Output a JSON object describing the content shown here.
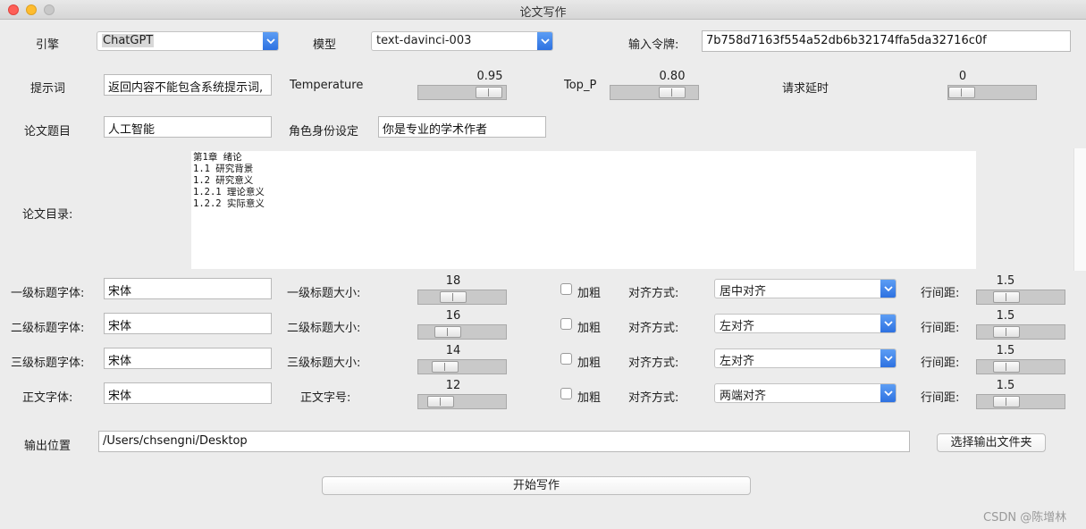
{
  "window": {
    "title": "论文写作"
  },
  "engine": {
    "label": "引擎",
    "value": "ChatGPT"
  },
  "model": {
    "label": "模型",
    "value": "text-davinci-003"
  },
  "token": {
    "label": "输入令牌:",
    "value": "7b758d7163f554a52db6b32174ffa5da32716c0f"
  },
  "prompt": {
    "label": "提示词",
    "value": "返回内容不能包含系统提示词,"
  },
  "temperature": {
    "label": "Temperature",
    "value": "0.95"
  },
  "top_p": {
    "label": "Top_P",
    "value": "0.80"
  },
  "delay": {
    "label": "请求延时",
    "value": "0"
  },
  "paper_title": {
    "label": "论文题目",
    "value": "人工智能"
  },
  "role": {
    "label": "角色身份设定",
    "value": "你是专业的学术作者"
  },
  "outline": {
    "label": "论文目录:",
    "text": "第1章 绪论\n1.1 研究背景\n1.2 研究意义\n1.2.1 理论意义\n1.2.2 实际意义"
  },
  "rows": [
    {
      "font_label": "一级标题字体:",
      "font": "宋体",
      "size_label": "一级标题大小:",
      "size": "18",
      "bold_label": "加粗",
      "align_label": "对齐方式:",
      "align": "居中对齐",
      "spacing_label": "行间距:",
      "spacing": "1.5"
    },
    {
      "font_label": "二级标题字体:",
      "font": "宋体",
      "size_label": "二级标题大小:",
      "size": "16",
      "bold_label": "加粗",
      "align_label": "对齐方式:",
      "align": "左对齐",
      "spacing_label": "行间距:",
      "spacing": "1.5"
    },
    {
      "font_label": "三级标题字体:",
      "font": "宋体",
      "size_label": "三级标题大小:",
      "size": "14",
      "bold_label": "加粗",
      "align_label": "对齐方式:",
      "align": "左对齐",
      "spacing_label": "行间距:",
      "spacing": "1.5"
    },
    {
      "font_label": "正文字体:",
      "font": "宋体",
      "size_label": "正文字号:",
      "size": "12",
      "bold_label": "加粗",
      "align_label": "对齐方式:",
      "align": "两端对齐",
      "spacing_label": "行间距:",
      "spacing": "1.5"
    }
  ],
  "output": {
    "label": "输出位置",
    "value": "/Users/chsengni/Desktop",
    "choose_button": "选择输出文件夹"
  },
  "start_button": "开始写作",
  "watermark": "CSDN @陈增林"
}
